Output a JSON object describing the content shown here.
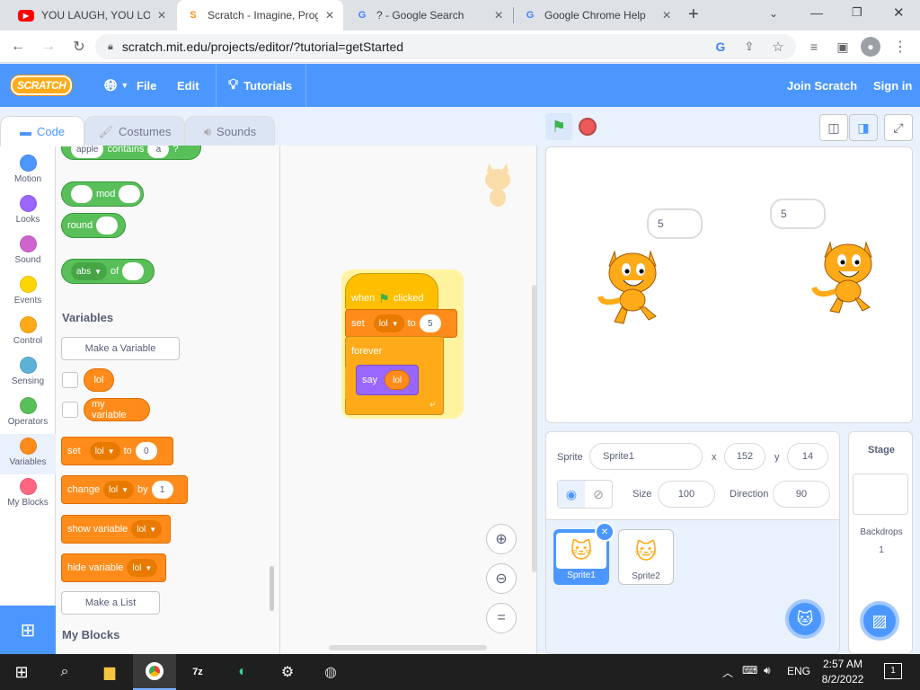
{
  "browser": {
    "tabs": [
      {
        "title": "YOU LAUGH, YOU LOSE",
        "icon": "youtube-icon"
      },
      {
        "title": "Scratch - Imagine, Prog",
        "icon": "scratch-icon"
      },
      {
        "title": "? - Google Search",
        "icon": "google-icon"
      },
      {
        "title": "Google Chrome Help",
        "icon": "google-icon"
      }
    ],
    "url": "scratch.mit.edu/projects/editor/?tutorial=getStarted"
  },
  "menu": {
    "logo": "SCRATCH",
    "file": "File",
    "edit": "Edit",
    "tutorials": "Tutorials",
    "join": "Join Scratch",
    "signin": "Sign in"
  },
  "editor_tabs": {
    "code": "Code",
    "costumes": "Costumes",
    "sounds": "Sounds"
  },
  "categories": [
    {
      "label": "Motion",
      "color": "#4c97ff"
    },
    {
      "label": "Looks",
      "color": "#9966ff"
    },
    {
      "label": "Sound",
      "color": "#cf63cf"
    },
    {
      "label": "Events",
      "color": "#ffd500"
    },
    {
      "label": "Control",
      "color": "#ffab19"
    },
    {
      "label": "Sensing",
      "color": "#5cb1d6"
    },
    {
      "label": "Operators",
      "color": "#59c059"
    },
    {
      "label": "Variables",
      "color": "#ff8c1a"
    },
    {
      "label": "My Blocks",
      "color": "#ff6680"
    }
  ],
  "palette": {
    "contains": {
      "a": "apple",
      "b": "contains",
      "c": "a",
      "d": "?"
    },
    "mod": "mod",
    "round": "round",
    "abs": "abs",
    "of": "of",
    "variables_header": "Variables",
    "make_variable": "Make a Variable",
    "var1": "lol",
    "var2": "my variable",
    "set": {
      "label": "set",
      "var": "lol",
      "to": "to",
      "val": "0"
    },
    "change": {
      "label": "change",
      "var": "lol",
      "by": "by",
      "val": "1"
    },
    "show": {
      "label": "show variable",
      "var": "lol"
    },
    "hide": {
      "label": "hide variable",
      "var": "lol"
    },
    "make_list": "Make a List",
    "myblocks_header": "My Blocks"
  },
  "script": {
    "when": "when",
    "clicked": "clicked",
    "set": "set",
    "var": "lol",
    "to": "to",
    "val": "5",
    "forever": "forever",
    "say": "say",
    "say_var": "lol"
  },
  "stage": {
    "bubble1": "5",
    "bubble2": "5"
  },
  "sprite_info": {
    "sprite_label": "Sprite",
    "sprite_name": "Sprite1",
    "x_label": "x",
    "x": "152",
    "y_label": "y",
    "y": "14",
    "show_label": "Show",
    "size_label": "Size",
    "size": "100",
    "direction_label": "Direction",
    "direction": "90"
  },
  "sprites": [
    {
      "name": "Sprite1"
    },
    {
      "name": "Sprite2"
    }
  ],
  "stage_pane": {
    "title": "Stage",
    "backdrops_label": "Backdrops",
    "backdrops": "1"
  },
  "taskbar": {
    "lang": "ENG",
    "time": "2:57 AM",
    "date": "8/2/2022",
    "notif": "1"
  }
}
